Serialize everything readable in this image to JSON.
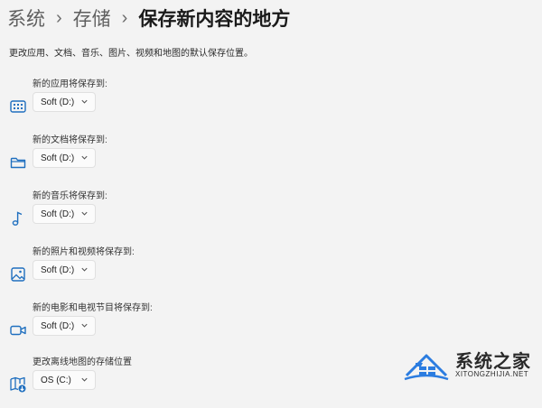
{
  "breadcrumb": {
    "items": [
      "系统",
      "存储"
    ],
    "current": "保存新内容的地方"
  },
  "description": "更改应用、文档、音乐、图片、视频和地图的默认保存位置。",
  "sections": [
    {
      "label": "新的应用将保存到:",
      "value": "Soft (D:)",
      "icon": "app-grid-icon"
    },
    {
      "label": "新的文档将保存到:",
      "value": "Soft (D:)",
      "icon": "folder-icon"
    },
    {
      "label": "新的音乐将保存到:",
      "value": "Soft (D:)",
      "icon": "music-note-icon"
    },
    {
      "label": "新的照片和视频将保存到:",
      "value": "Soft (D:)",
      "icon": "picture-icon"
    },
    {
      "label": "新的电影和电视节目将保存到:",
      "value": "Soft (D:)",
      "icon": "video-icon"
    },
    {
      "label": "更改离线地图的存储位置",
      "value": "OS (C:)",
      "icon": "map-download-icon"
    }
  ],
  "watermark": {
    "title": "系统之家",
    "subtitle": "XITONGZHIJIA.NET"
  },
  "colors": {
    "background": "#f3f3f3",
    "icon_accent": "#1f6fbf",
    "watermark_blue": "#2b7ce0"
  }
}
